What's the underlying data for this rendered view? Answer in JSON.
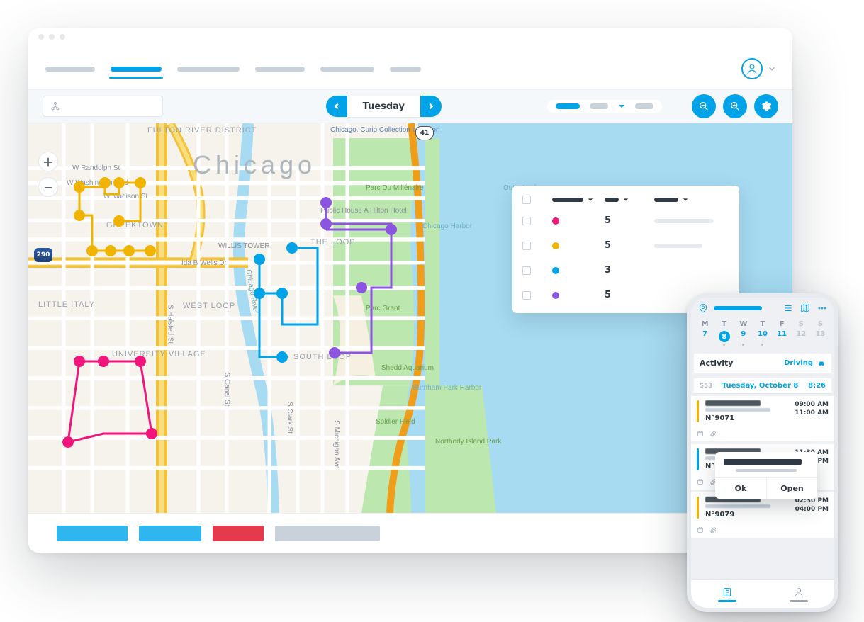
{
  "nav": {
    "active_index": 1
  },
  "toolbar": {
    "day_label": "Tuesday"
  },
  "map": {
    "city_label": "Chicago",
    "labels": {
      "fulton_river": "FULTON RIVER DISTRICT",
      "randolph": "W Randolph St",
      "washington": "W Washington Blvd",
      "madison": "W Madison St",
      "greektown": "GREEKTOWN",
      "willis": "WILLIS TOWER",
      "idab": "Ida B Wells Dr",
      "little_italy": "LITTLE ITALY",
      "westloop": "WEST LOOP",
      "univ_village": "UNIVERSITY VILLAGE",
      "halsted": "S Halsted St",
      "canal": "S Canal St",
      "clark": "S Clark St",
      "michigan": "S Michigan Ave",
      "chicago_river": "Chicago River",
      "parc_mill": "Parc Du Millénaire",
      "loop": "THE LOOP",
      "pubhouse": "Public House A Hilton Hotel",
      "harbor": "Chicago Harbor",
      "outer": "Outer Harbor",
      "southloop": "SOUTH LOOP",
      "shedd": "Shedd Aquarium",
      "grant": "Parc Grant",
      "burnham": "Burnham Park Harbor",
      "soldier": "Soldier Field",
      "northerly": "Northerly Island Park",
      "curio": "Chicago, Curio Collection by Hilton"
    },
    "hw_290": "290",
    "hw_41": "41"
  },
  "legend": {
    "rows": [
      {
        "color": "#F0157B",
        "count": "5"
      },
      {
        "color": "#F0B400",
        "count": "5"
      },
      {
        "color": "#00A3E7",
        "count": "3"
      },
      {
        "color": "#8C55E0",
        "count": "5"
      }
    ]
  },
  "phone": {
    "week": {
      "dow": [
        "M",
        "T",
        "W",
        "T",
        "F",
        "S",
        "S"
      ],
      "days": [
        "7",
        "8",
        "9",
        "10",
        "11",
        "12",
        "13"
      ],
      "selected": 1
    },
    "activity_label": "Activity",
    "activity_mode": "Driving",
    "date_tag": "S53",
    "date_label": "Tuesday, October 8",
    "date_time": "8:26",
    "entries": [
      {
        "code": "N°9071",
        "t1": "09:00 AM",
        "t2": "11:00 AM",
        "edge": "yellow"
      },
      {
        "code": "N°8965",
        "t1": "11:30 AM",
        "t2": "01:30 PM",
        "edge": "blue"
      },
      {
        "code": "N°9079",
        "t1": "02:30 PM",
        "t2": "04:00 PM",
        "edge": "yellow"
      }
    ],
    "popup": {
      "ok": "Ok",
      "open": "Open"
    }
  }
}
